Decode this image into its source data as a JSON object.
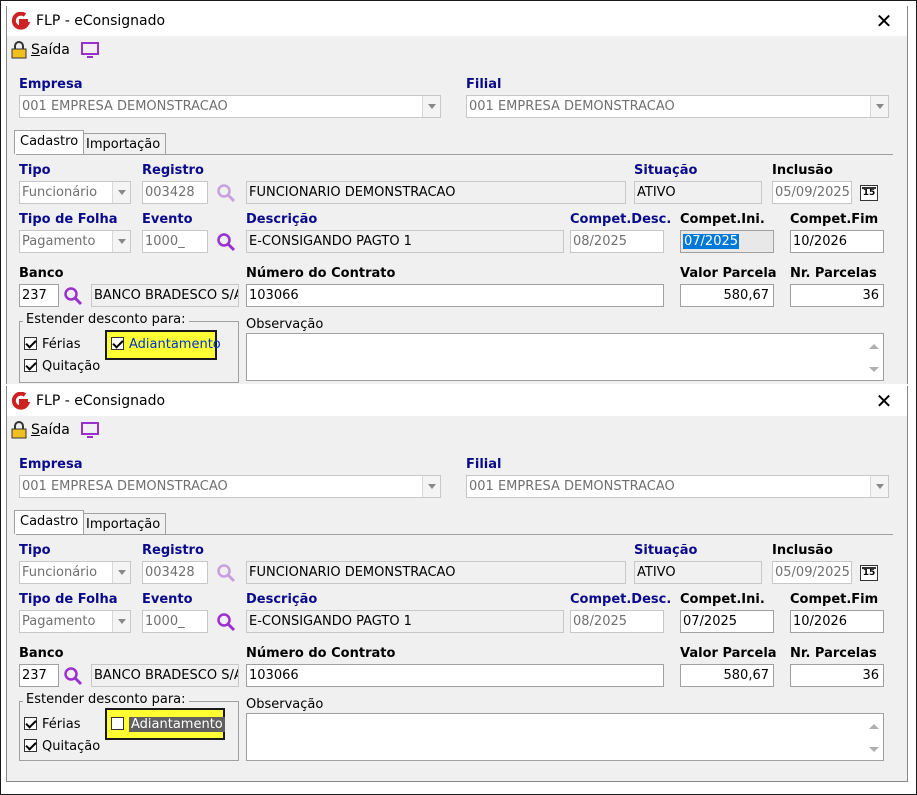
{
  "colors": {
    "label_blue": "#0a0a8c",
    "highlight": "#ffff33",
    "logo_red": "#cc2222",
    "icon_purple": "#9b30d0"
  },
  "windows": [
    {
      "title": "FLP - eConsignado",
      "close": "✕",
      "toolbar": {
        "saida_underlined": "S",
        "saida_rest": "aída"
      },
      "empresa": {
        "label": "Empresa",
        "value": "001 EMPRESA DEMONSTRACAO"
      },
      "filial": {
        "label": "Filial",
        "value": "001 EMPRESA DEMONSTRACAO"
      },
      "tabs": [
        {
          "label": "Cadastro"
        },
        {
          "label": "Importação"
        }
      ],
      "tipo": {
        "label": "Tipo",
        "value": "Funcionário"
      },
      "registro": {
        "label": "Registro",
        "value": "003428",
        "name": "FUNCIONARIO DEMONSTRACAO"
      },
      "situacao": {
        "label": "Situação",
        "value": "ATIVO"
      },
      "inclusao": {
        "label": "Inclusão",
        "value": "05/09/2025",
        "cal": "15"
      },
      "tipo_folha": {
        "label": "Tipo de Folha",
        "value": "Pagamento"
      },
      "evento": {
        "label": "Evento",
        "value": "1000_"
      },
      "descricao": {
        "label": "Descrição",
        "value": "E-CONSIGANDO PAGTO 1"
      },
      "compet_desc": {
        "label": "Compet.Desc.",
        "value": "08/2025"
      },
      "compet_ini": {
        "label": "Compet.Ini.",
        "value": "07/2025"
      },
      "compet_fim": {
        "label": "Compet.Fim",
        "value": "10/2026"
      },
      "banco": {
        "label": "Banco",
        "code": "237",
        "name": "BANCO BRADESCO S/A"
      },
      "numero_contrato": {
        "label": "Número do Contrato",
        "value": "103066"
      },
      "valor_parcela": {
        "label": "Valor Parcela",
        "value": "580,67"
      },
      "nr_parcelas": {
        "label": "Nr. Parcelas",
        "value": "36"
      },
      "estender": {
        "label": "Estender desconto para:",
        "ferias": "Férias",
        "adiantamento": "Adiantamento",
        "quitacao": "Quitação",
        "ferias_checked": true,
        "adiantamento_checked": true,
        "quitacao_checked": true
      },
      "observacao": {
        "label": "Observação",
        "value": ""
      }
    },
    {
      "title": "FLP - eConsignado",
      "close": "✕",
      "toolbar": {
        "saida_underlined": "S",
        "saida_rest": "aída"
      },
      "empresa": {
        "label": "Empresa",
        "value": "001 EMPRESA DEMONSTRACAO"
      },
      "filial": {
        "label": "Filial",
        "value": "001 EMPRESA DEMONSTRACAO"
      },
      "tabs": [
        {
          "label": "Cadastro"
        },
        {
          "label": "Importação"
        }
      ],
      "tipo": {
        "label": "Tipo",
        "value": "Funcionário"
      },
      "registro": {
        "label": "Registro",
        "value": "003428",
        "name": "FUNCIONARIO DEMONSTRACAO"
      },
      "situacao": {
        "label": "Situação",
        "value": "ATIVO"
      },
      "inclusao": {
        "label": "Inclusão",
        "value": "05/09/2025",
        "cal": "15"
      },
      "tipo_folha": {
        "label": "Tipo de Folha",
        "value": "Pagamento"
      },
      "evento": {
        "label": "Evento",
        "value": "1000_"
      },
      "descricao": {
        "label": "Descrição",
        "value": "E-CONSIGANDO PAGTO 1"
      },
      "compet_desc": {
        "label": "Compet.Desc.",
        "value": "08/2025"
      },
      "compet_ini": {
        "label": "Compet.Ini.",
        "value": "07/2025"
      },
      "compet_fim": {
        "label": "Compet.Fim",
        "value": "10/2026"
      },
      "banco": {
        "label": "Banco",
        "code": "237",
        "name": "BANCO BRADESCO S/A"
      },
      "numero_contrato": {
        "label": "Número do Contrato",
        "value": "103066"
      },
      "valor_parcela": {
        "label": "Valor Parcela",
        "value": "580,67"
      },
      "nr_parcelas": {
        "label": "Nr. Parcelas",
        "value": "36"
      },
      "estender": {
        "label": "Estender desconto para:",
        "ferias": "Férias",
        "adiantamento": "Adiantamento",
        "quitacao": "Quitação",
        "ferias_checked": true,
        "adiantamento_checked": false,
        "quitacao_checked": true
      },
      "observacao": {
        "label": "Observação",
        "value": ""
      }
    }
  ]
}
